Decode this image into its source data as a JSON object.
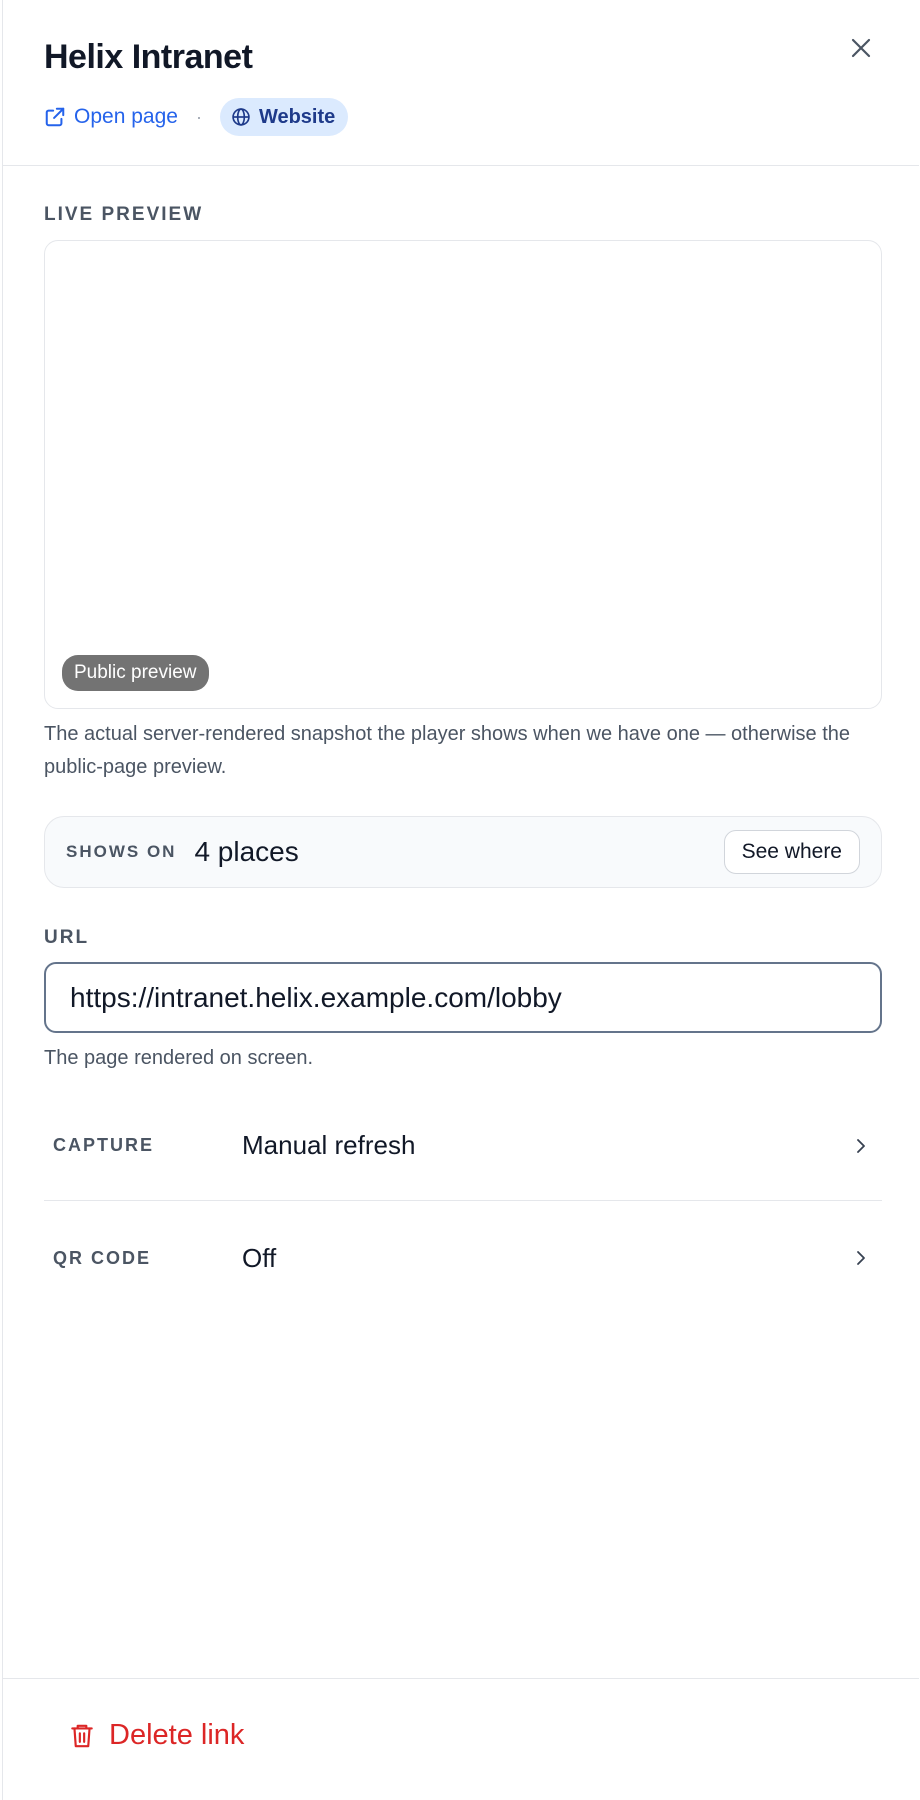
{
  "header": {
    "title": "Helix Intranet",
    "open_link_label": "Open page",
    "separator": "·",
    "type_badge": "Website",
    "close_icon": "close-icon"
  },
  "preview": {
    "label": "LIVE PREVIEW",
    "pill": "Public preview",
    "help": "The actual server-rendered snapshot the player shows when we have one — otherwise the public-page preview."
  },
  "shows_on": {
    "label": "SHOWS ON",
    "value": "4 places",
    "button": "See where"
  },
  "url": {
    "label": "URL",
    "value": "https://intranet.helix.example.com/lobby",
    "help": "The page rendered on screen."
  },
  "settings": [
    {
      "label": "CAPTURE",
      "value": "Manual refresh"
    },
    {
      "label": "QR CODE",
      "value": "Off"
    }
  ],
  "footer": {
    "delete_label": "Delete link"
  },
  "colors": {
    "accent": "#2563eb",
    "badge_bg": "#dbeafe",
    "danger": "#dc2626"
  }
}
